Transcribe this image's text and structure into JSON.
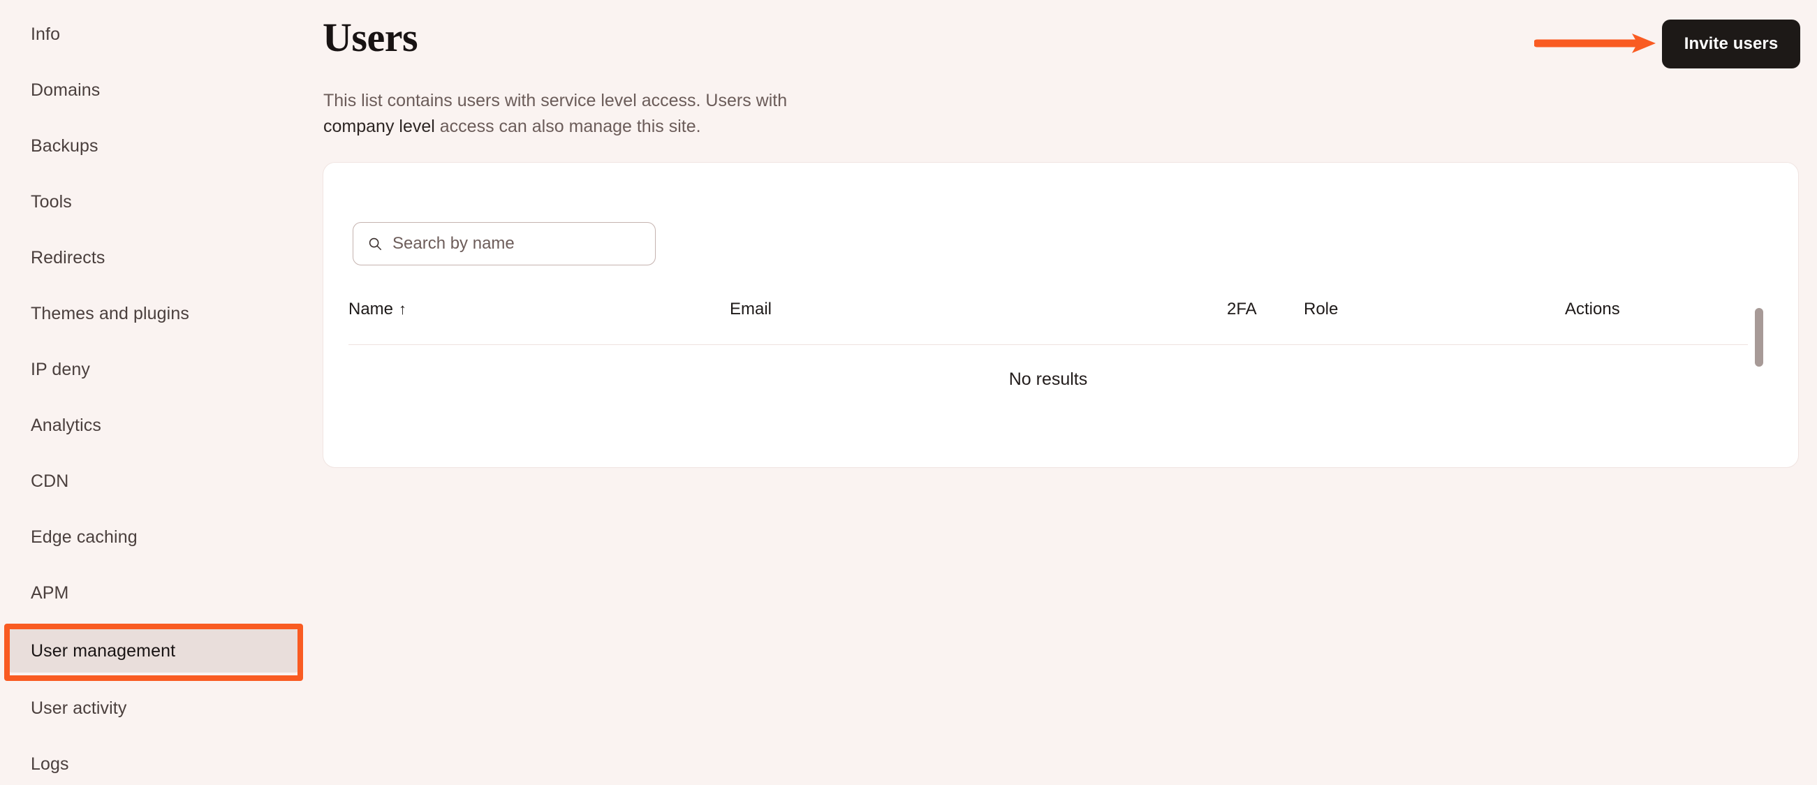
{
  "sidebar": {
    "items": [
      {
        "label": "Info",
        "active": false
      },
      {
        "label": "Domains",
        "active": false
      },
      {
        "label": "Backups",
        "active": false
      },
      {
        "label": "Tools",
        "active": false
      },
      {
        "label": "Redirects",
        "active": false
      },
      {
        "label": "Themes and plugins",
        "active": false
      },
      {
        "label": "IP deny",
        "active": false
      },
      {
        "label": "Analytics",
        "active": false
      },
      {
        "label": "CDN",
        "active": false
      },
      {
        "label": "Edge caching",
        "active": false
      },
      {
        "label": "APM",
        "active": false
      },
      {
        "label": "User management",
        "active": true
      },
      {
        "label": "User activity",
        "active": false
      },
      {
        "label": "Logs",
        "active": false
      }
    ]
  },
  "header": {
    "title": "Users",
    "description_part1": "This list contains users with service level access. Users with ",
    "description_strong": "company level",
    "description_part2": " access can also manage this site.",
    "invite_button_label": "Invite users"
  },
  "search": {
    "placeholder": "Search by name",
    "value": "",
    "icon": "search-icon"
  },
  "table": {
    "columns": [
      {
        "label": "Name",
        "sort": "↑"
      },
      {
        "label": "Email",
        "sort": ""
      },
      {
        "label": "2FA",
        "sort": ""
      },
      {
        "label": "Role",
        "sort": ""
      },
      {
        "label": "Actions",
        "sort": ""
      }
    ],
    "rows": [],
    "empty_message": "No results"
  },
  "annotations": {
    "arrow_color": "#f95b22",
    "box_color": "#f95b22",
    "target": "invite-users-button",
    "box_target": "sidebar-item-user-management"
  },
  "colors": {
    "page_background": "#faf3f1",
    "card_background": "#ffffff",
    "active_nav_background": "#e9dedb",
    "button_background": "#1d1917",
    "accent_orange": "#f95b22",
    "text_primary": "#1e1a19",
    "text_muted": "#6b5c59"
  }
}
